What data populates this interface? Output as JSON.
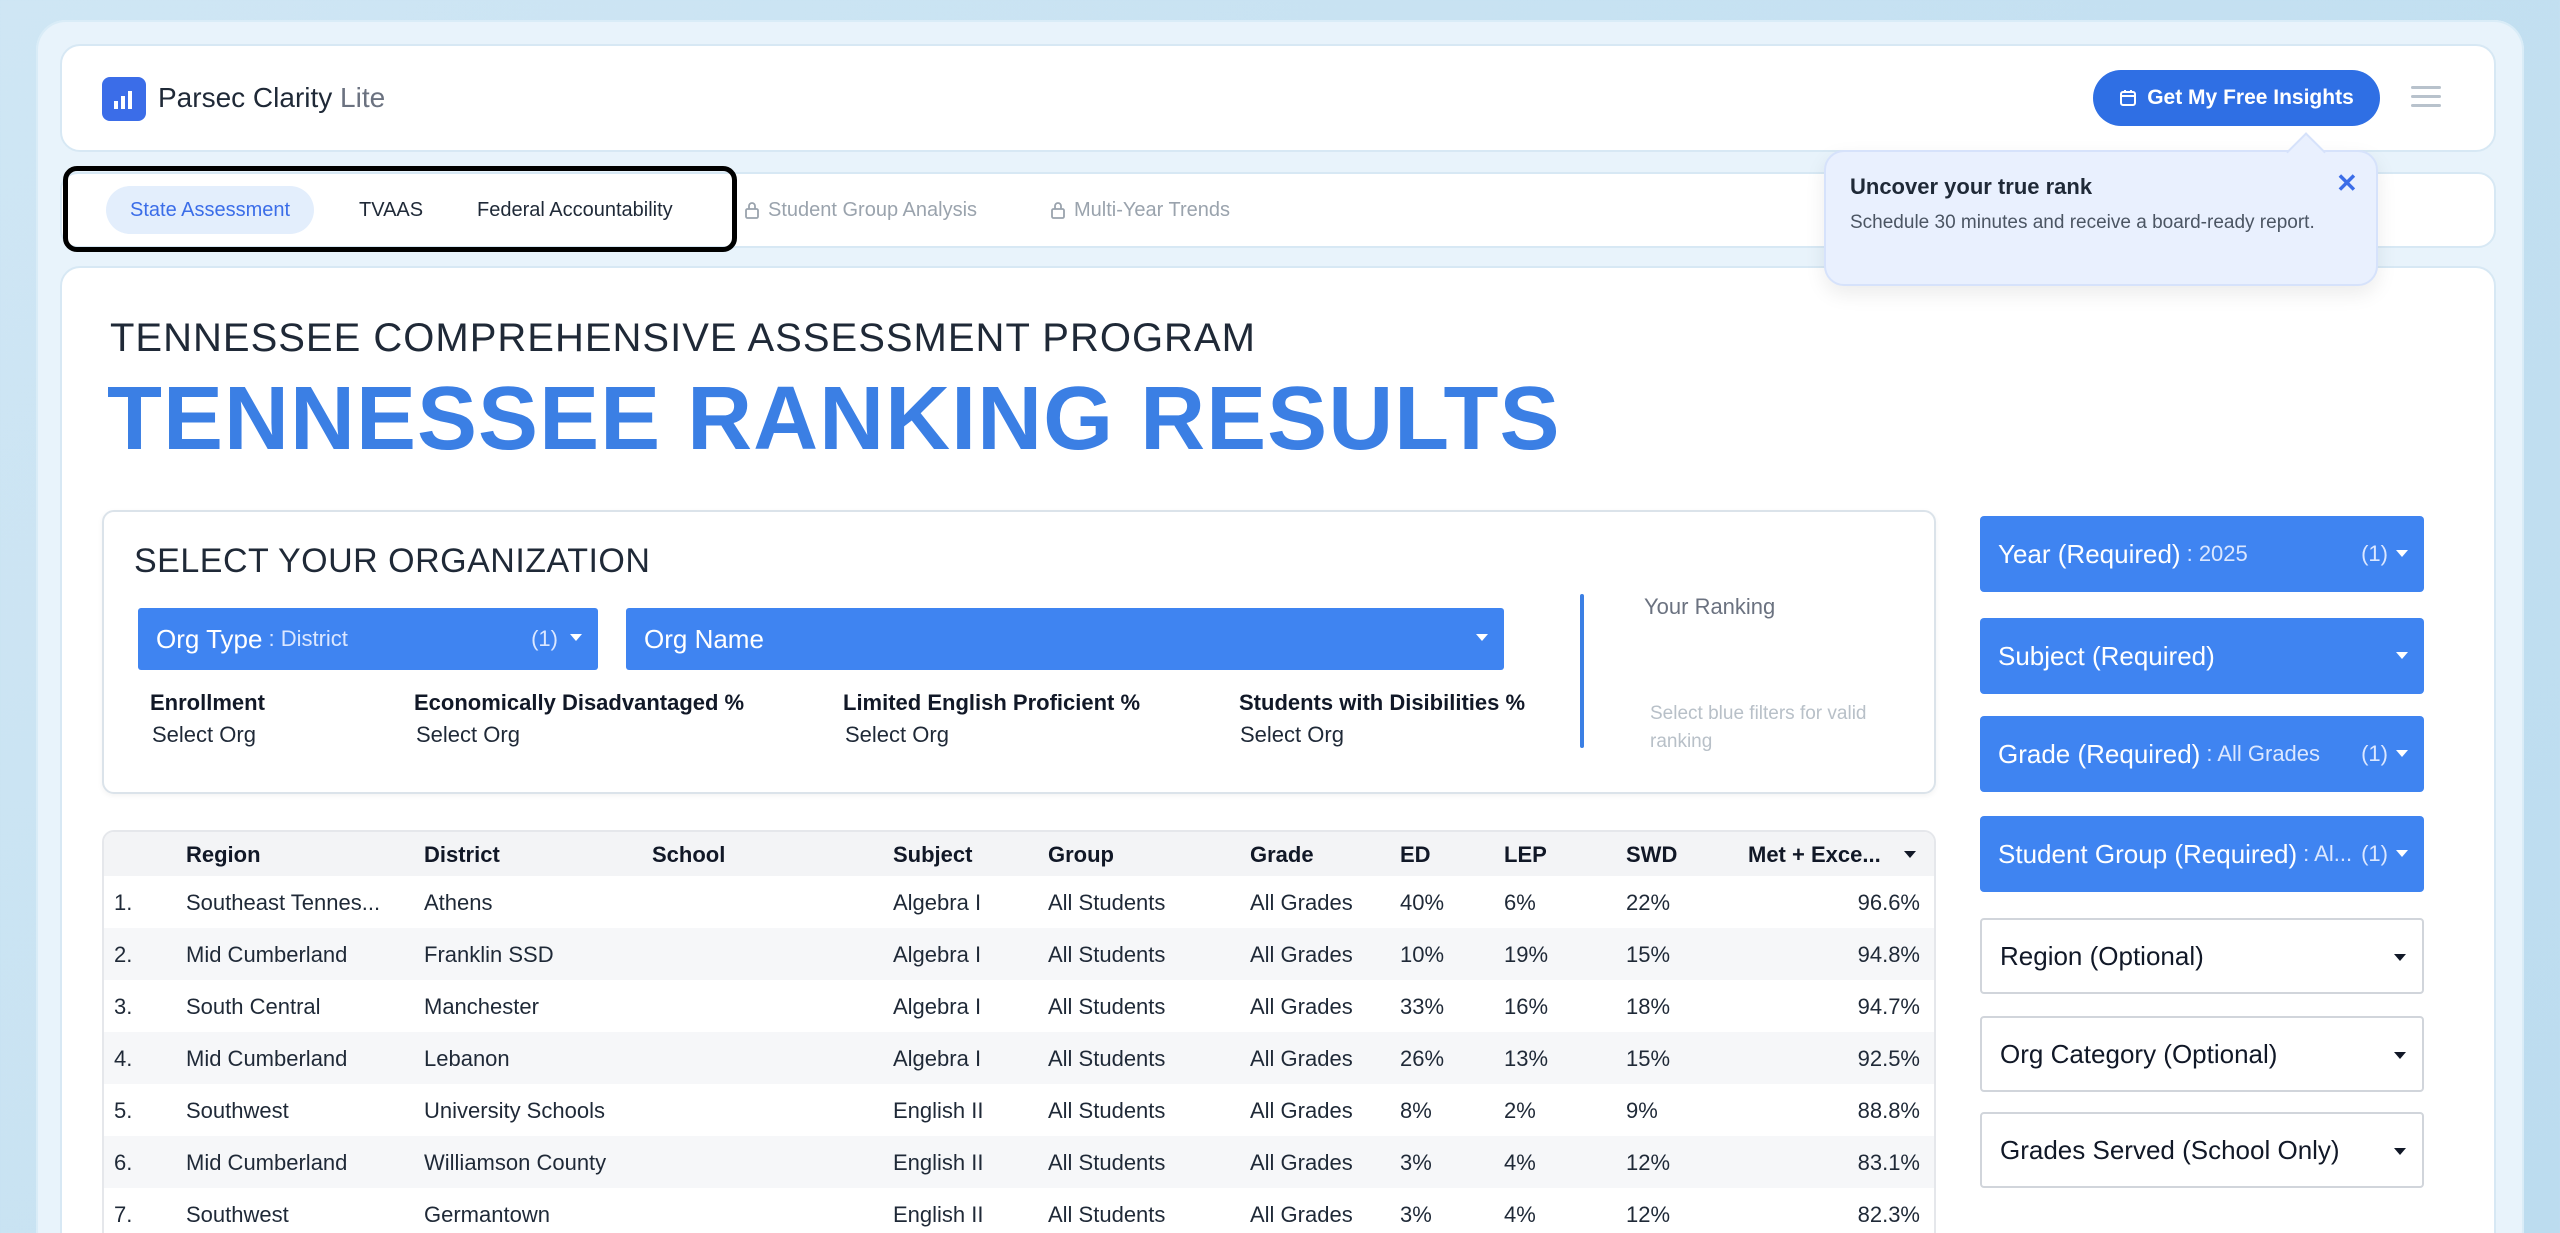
{
  "app": {
    "name": "Parsec Clarity",
    "name_suffix": "Lite"
  },
  "header": {
    "cta_label": "Get My Free Insights"
  },
  "tabs": [
    {
      "label": "State Assessment",
      "state": "active"
    },
    {
      "label": "TVAAS",
      "state": "normal"
    },
    {
      "label": "Federal Accountability",
      "state": "normal"
    },
    {
      "label": "Student Group Analysis",
      "state": "locked"
    },
    {
      "label": "Multi-Year Trends",
      "state": "locked"
    }
  ],
  "tooltip": {
    "title": "Uncover your true rank",
    "body": "Schedule 30 minutes and receive a board-ready report."
  },
  "page": {
    "subtitle": "TENNESSEE COMPREHENSIVE ASSESSMENT PROGRAM",
    "title": "TENNESSEE RANKING RESULTS"
  },
  "org": {
    "heading": "SELECT YOUR ORGANIZATION",
    "org_type": {
      "label": "Org Type",
      "value": ": District",
      "count": "(1)"
    },
    "org_name": {
      "label": "Org Name"
    },
    "stats": [
      {
        "label": "Enrollment",
        "value": "Select Org"
      },
      {
        "label": "Economically Disadvantaged %",
        "value": "Select Org"
      },
      {
        "label": "Limited English Proficient %",
        "value": "Select Org"
      },
      {
        "label": "Students with Disibilities %",
        "value": "Select Org"
      }
    ],
    "ranking_label": "Your Ranking",
    "ranking_hint": "Select blue filters for valid ranking"
  },
  "table": {
    "columns": [
      "Region",
      "District",
      "School",
      "Subject",
      "Group",
      "Grade",
      "ED",
      "LEP",
      "SWD",
      "Met + Exce..."
    ],
    "rows": [
      {
        "num": "1.",
        "region": "Southeast Tennes...",
        "district": "Athens",
        "school": "",
        "subject": "Algebra I",
        "group": "All Students",
        "grade": "All Grades",
        "ed": "40%",
        "lep": "6%",
        "swd": "22%",
        "met": "96.6%"
      },
      {
        "num": "2.",
        "region": "Mid Cumberland",
        "district": "Franklin SSD",
        "school": "",
        "subject": "Algebra I",
        "group": "All Students",
        "grade": "All Grades",
        "ed": "10%",
        "lep": "19%",
        "swd": "15%",
        "met": "94.8%"
      },
      {
        "num": "3.",
        "region": "South Central",
        "district": "Manchester",
        "school": "",
        "subject": "Algebra I",
        "group": "All Students",
        "grade": "All Grades",
        "ed": "33%",
        "lep": "16%",
        "swd": "18%",
        "met": "94.7%"
      },
      {
        "num": "4.",
        "region": "Mid Cumberland",
        "district": "Lebanon",
        "school": "",
        "subject": "Algebra I",
        "group": "All Students",
        "grade": "All Grades",
        "ed": "26%",
        "lep": "13%",
        "swd": "15%",
        "met": "92.5%"
      },
      {
        "num": "5.",
        "region": "Southwest",
        "district": "University Schools",
        "school": "",
        "subject": "English II",
        "group": "All Students",
        "grade": "All Grades",
        "ed": "8%",
        "lep": "2%",
        "swd": "9%",
        "met": "88.8%"
      },
      {
        "num": "6.",
        "region": "Mid Cumberland",
        "district": "Williamson County",
        "school": "",
        "subject": "English II",
        "group": "All Students",
        "grade": "All Grades",
        "ed": "3%",
        "lep": "4%",
        "swd": "12%",
        "met": "83.1%"
      },
      {
        "num": "7.",
        "region": "Southwest",
        "district": "Germantown",
        "school": "",
        "subject": "English II",
        "group": "All Students",
        "grade": "All Grades",
        "ed": "3%",
        "lep": "4%",
        "swd": "12%",
        "met": "82.3%"
      }
    ]
  },
  "filters": [
    {
      "label": "Year (Required)",
      "value": ": 2025",
      "count": "(1)",
      "style": "blue"
    },
    {
      "label": "Subject (Required)",
      "value": "",
      "count": "",
      "style": "blue"
    },
    {
      "label": "Grade (Required)",
      "value": ": All Grades",
      "count": "(1)",
      "style": "blue"
    },
    {
      "label": "Student Group (Required)",
      "value": ": Al...",
      "count": "(1)",
      "style": "blue"
    },
    {
      "label": "Region (Optional)",
      "value": "",
      "count": "",
      "style": "white"
    },
    {
      "label": "Org Category (Optional)",
      "value": "",
      "count": "",
      "style": "white"
    },
    {
      "label": "Grades Served (School Only)",
      "value": "",
      "count": "",
      "style": "white"
    }
  ],
  "colors": {
    "accent": "#3f84f1",
    "title": "#3b7fe4",
    "cta": "#2f6fe4"
  }
}
